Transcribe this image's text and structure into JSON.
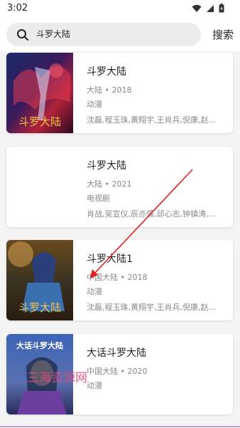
{
  "status": {
    "time": "3:02"
  },
  "search": {
    "query": "斗罗大陆",
    "button_label": "搜索"
  },
  "results": [
    {
      "title": "斗罗大陆",
      "region": "大陆",
      "year": "2018",
      "genre": "动漫",
      "cast": "沈磊,程玉珠,黄翔宇,王肖兵,倪康,赵..."
    },
    {
      "title": "斗罗大陆",
      "region": "大陆",
      "year": "2021",
      "genre": "电视剧",
      "cast": "肖战,吴宣仪,辰亦儒,邱心志,钟镇涛,..."
    },
    {
      "title": "斗罗大陆1",
      "region": "中国大陆",
      "year": "2018",
      "genre": "动漫",
      "cast": "沈磊,程玉珠,黄翔宇,王肖兵,倪康,赵..."
    },
    {
      "title": "大话斗罗大陆",
      "region": "中国大陆",
      "year": "2020",
      "genre": "动漫"
    }
  ],
  "posters": {
    "poster1_text": "斗罗大陆",
    "poster3_text": "斗罗大陆",
    "poster4_text": "大话斗罗大陆"
  },
  "watermark": "三海资源网",
  "colors": {
    "arrow": "#e02020",
    "watermark": "#e04a7c"
  }
}
